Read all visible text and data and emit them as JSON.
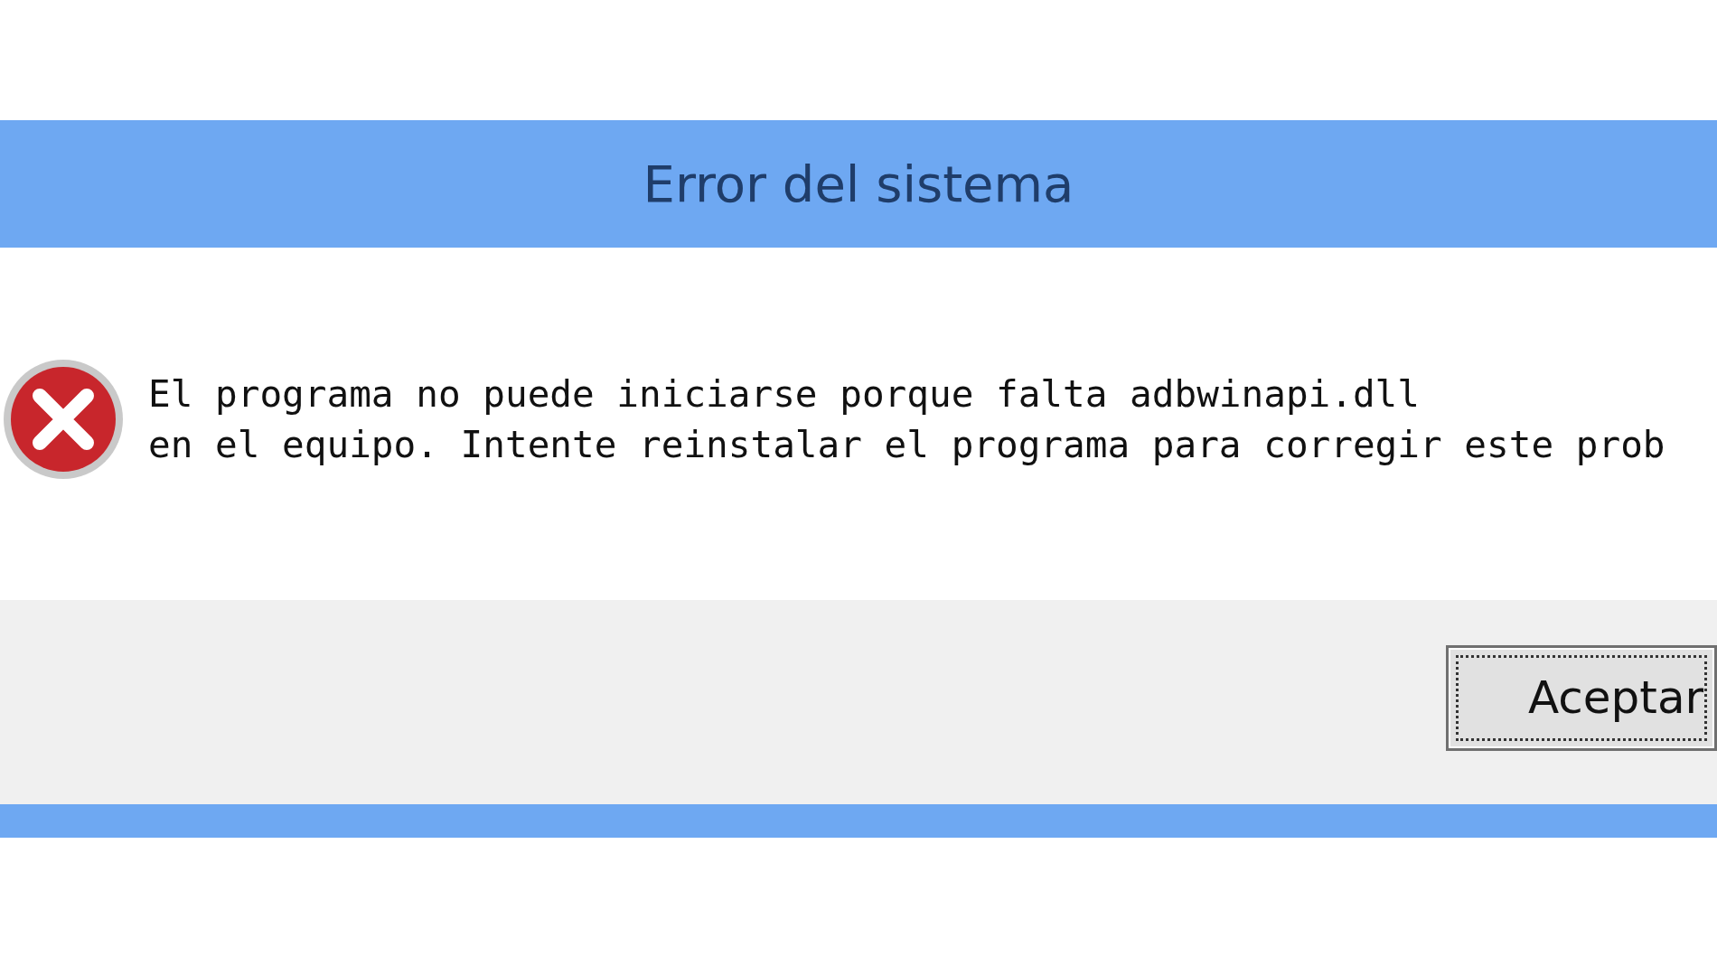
{
  "window": {
    "title": "Error del sistema"
  },
  "message": {
    "lines": [
      "El programa no puede iniciarse porque falta adbwinapi.dll",
      "en el equipo. Intente reinstalar el programa para corregir este prob"
    ]
  },
  "buttons": [
    {
      "label": "Aceptar",
      "focused": true
    }
  ]
}
